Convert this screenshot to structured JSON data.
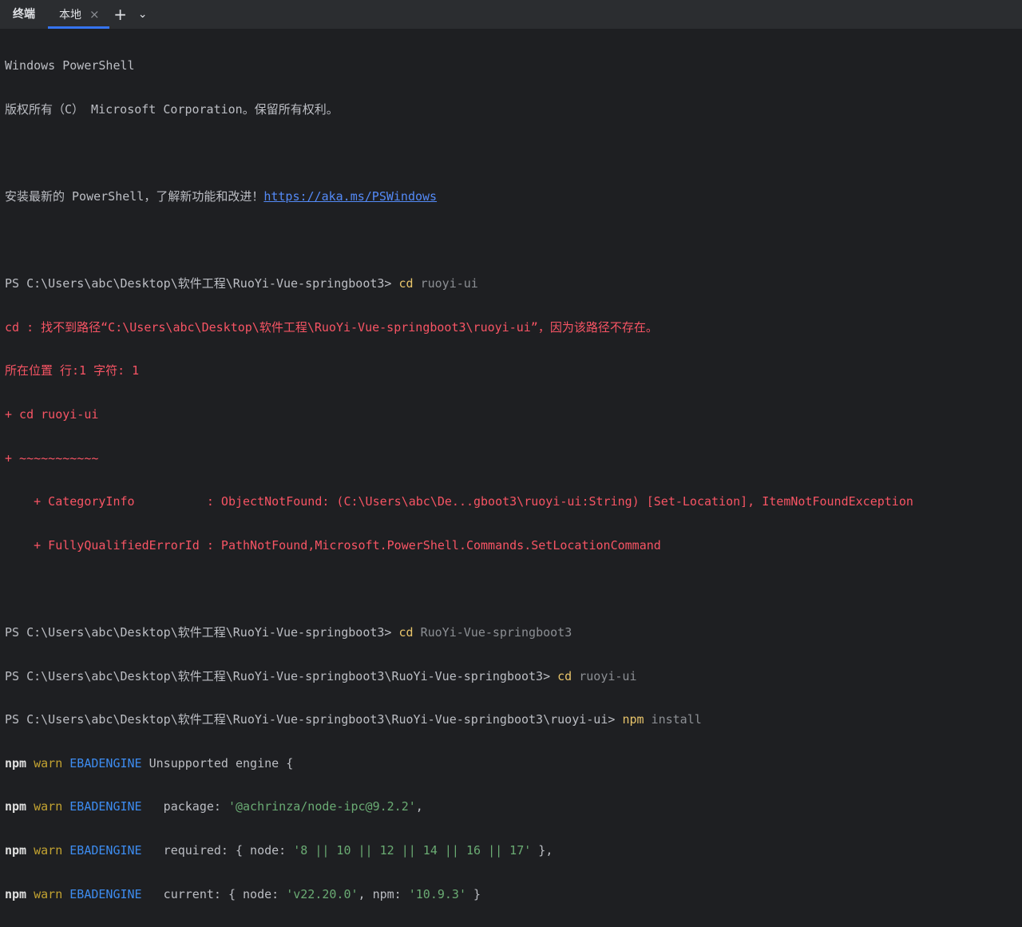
{
  "tabs": {
    "title": "终端",
    "active": "本地",
    "close": "×",
    "add": "+",
    "more": "⌄"
  },
  "lines": {
    "l1": "Windows PowerShell",
    "l2": "版权所有（C） Microsoft Corporation。保留所有权利。",
    "l3a": "安装最新的 PowerShell，了解新功能和改进！",
    "l3b": "https://aka.ms/PSWindows",
    "p1": "PS C:\\Users\\abc\\Desktop\\软件工程\\RuoYi-Vue-springboot3> ",
    "c1": "cd",
    "a1": " ruoyi-ui",
    "e1": "cd : 找不到路径“C:\\Users\\abc\\Desktop\\软件工程\\RuoYi-Vue-springboot3\\ruoyi-ui”，因为该路径不存在。",
    "e2": "所在位置 行:1 字符: 1",
    "e3": "+ cd ruoyi-ui",
    "e4": "+ ~~~~~~~~~~~",
    "e5": "    + CategoryInfo          : ObjectNotFound: (C:\\Users\\abc\\De...gboot3\\ruoyi-ui:String) [Set-Location], ItemNotFoundException",
    "e6": "    + FullyQualifiedErrorId : PathNotFound,Microsoft.PowerShell.Commands.SetLocationCommand",
    "p2": "PS C:\\Users\\abc\\Desktop\\软件工程\\RuoYi-Vue-springboot3> ",
    "c2": "cd",
    "a2": " RuoYi-Vue-springboot3",
    "p3": "PS C:\\Users\\abc\\Desktop\\软件工程\\RuoYi-Vue-springboot3\\RuoYi-Vue-springboot3> ",
    "c3": "cd",
    "a3": " ruoyi-ui",
    "p4": "PS C:\\Users\\abc\\Desktop\\软件工程\\RuoYi-Vue-springboot3\\RuoYi-Vue-springboot3\\ruoyi-ui> ",
    "c4": "npm",
    "a4": " install"
  },
  "npm": {
    "npm": "npm",
    "warn": "warn",
    "code": "EBADENGINE",
    "w1": " Unsupported engine {",
    "w2a": "   package: ",
    "w2s": "'@achrinza/node-ipc@9.2.2'",
    "w2b": ",",
    "w3a": "   required: { node: ",
    "w3s": "'8 || 10 || 12 || 14 || 16 || 17'",
    "w3b": " },",
    "w4a": "   current: { node: ",
    "w4s": "'v22.20.0'",
    "w4b": ", npm: ",
    "w4t": "'10.9.3'",
    "w4c": " }"
  }
}
